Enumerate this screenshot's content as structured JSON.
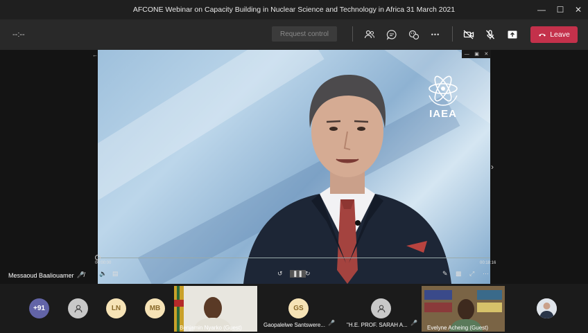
{
  "window": {
    "title": "AFCONE Webinar on Capacity Building in Nuclear Science and Technology in Africa 31 March 2021",
    "minimize": "—",
    "maximize": "☐",
    "close": "✕"
  },
  "toolbar": {
    "timer": "--:--",
    "request_control": "Request control",
    "more": "•••",
    "leave": "Leave"
  },
  "video": {
    "logo_text": "IAEA",
    "time_current": "00:00:00",
    "time_end": "00:18:16",
    "speaker": "Messaoud Baaliouamer"
  },
  "participants": {
    "overflow": "+91",
    "initials": [
      "LN",
      "MB",
      "GS"
    ],
    "names": [
      "Benjamin Nyarko (Guest)",
      "Gaopalelwe Santswere...",
      "\"H.E. PROF. SARAH A...",
      "Evelyne Acheing (Guest)"
    ]
  },
  "colors": {
    "leave": "#c4314b",
    "overflow_avatar": "#6264a7",
    "initials_avatar": "#f6e3b6"
  }
}
